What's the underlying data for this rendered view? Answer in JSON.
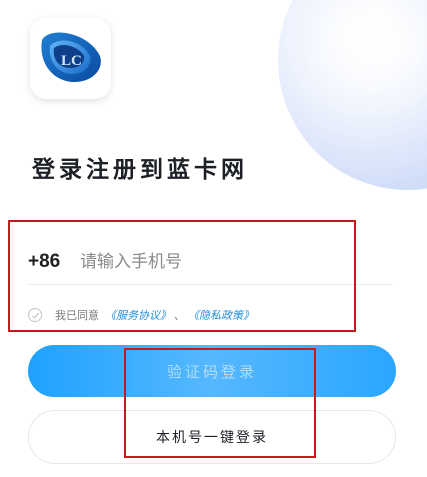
{
  "app": {
    "logo_icon": "lc-app-logo-icon"
  },
  "headline": "登录注册到蓝卡网",
  "phone": {
    "country_code": "+86",
    "placeholder": "请输入手机号",
    "value": ""
  },
  "agreement": {
    "checked": false,
    "prefix": "我已同意",
    "service_link": "《服务协议》",
    "separator": "、",
    "privacy_link": "《隐私政策》"
  },
  "buttons": {
    "code_login": "验证码登录",
    "local_login": "本机号一键登录"
  },
  "colors": {
    "accent": "#1fa2ff",
    "link": "#1d8fe3",
    "annotation": "#c81a1a"
  }
}
